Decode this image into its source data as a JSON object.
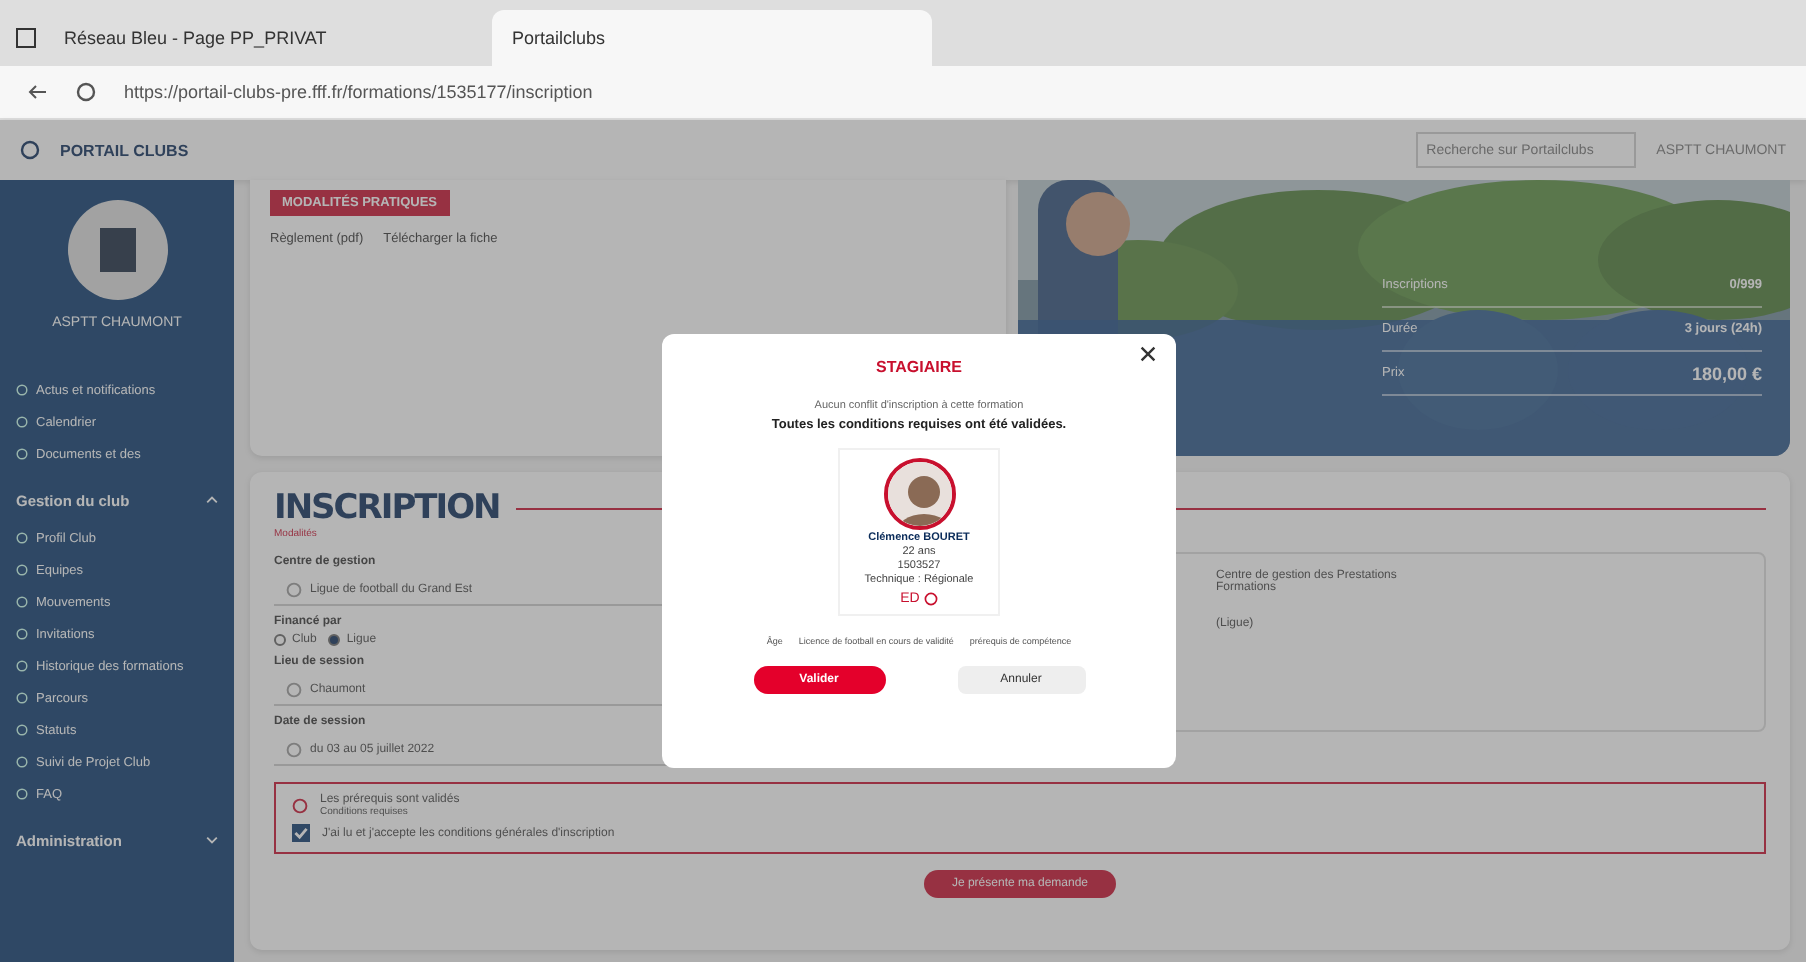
{
  "browser": {
    "tabs": [
      {
        "label": "Réseau Bleu - Page PP_PRIVAT",
        "selected": false
      },
      {
        "label": "Portailclubs",
        "selected": true
      }
    ],
    "url": "https://portail-clubs-pre.fff.fr/formations/1535177/inscription"
  },
  "header": {
    "logo": "PORTAIL CLUBS",
    "search_placeholder": "Recherche sur Portailclubs",
    "user": "ASPTT CHAUMONT"
  },
  "sidebar": {
    "club": "ASPTT CHAUMONT",
    "items": [
      {
        "label": "Actus et notifications",
        "kind": "item"
      },
      {
        "label": "Calendrier",
        "kind": "item"
      },
      {
        "label": "Documents et des",
        "kind": "item"
      },
      {
        "label": "Gestion du club",
        "kind": "section",
        "expanded": true
      },
      {
        "label": "Profil Club",
        "kind": "item"
      },
      {
        "label": "Equipes",
        "kind": "item"
      },
      {
        "label": "Mouvements",
        "kind": "item"
      },
      {
        "label": "Invitations",
        "kind": "item"
      },
      {
        "label": "Historique des formations",
        "kind": "item"
      },
      {
        "label": "Parcours",
        "kind": "item"
      },
      {
        "label": "Statuts",
        "kind": "item"
      },
      {
        "label": "Suivi de Projet Club",
        "kind": "item"
      },
      {
        "label": "FAQ",
        "kind": "item"
      },
      {
        "label": "Administration",
        "kind": "section",
        "expanded": false
      }
    ]
  },
  "info_card": {
    "badge": "MODALITÉS PRATIQUES",
    "links": [
      "Règlement (pdf)",
      "Télécharger la fiche"
    ]
  },
  "stats": [
    {
      "label": "Inscriptions",
      "value": "0/999"
    },
    {
      "label": "Durée",
      "value": "3 jours (24h)"
    },
    {
      "label": "Prix",
      "value": "180,00 €"
    }
  ],
  "inscription": {
    "title": "INSCRIPTION",
    "subtitle": "Modalités",
    "fields": [
      {
        "label": "Centre de gestion",
        "value": "Ligue de football du Grand Est",
        "kind": "select"
      },
      {
        "label": "Financé par",
        "kind": "radio",
        "options": [
          {
            "label": "Club",
            "selected": false
          },
          {
            "label": "Ligue",
            "selected": true
          }
        ]
      },
      {
        "label": "Lieu de session",
        "value": "Chaumont",
        "kind": "select"
      },
      {
        "label": "Date de session",
        "value": "du 03 au 05 juillet 2022",
        "kind": "select"
      }
    ],
    "right_note": [
      "Centre de gestion des Prestations",
      "Formations"
    ],
    "right_value": "(Ligue)",
    "warning": {
      "title": "Les prérequis sont validés",
      "subtitle": "Conditions requises",
      "checkbox": {
        "label": "J'ai lu et j'accepte les conditions générales d'inscription",
        "checked": true
      }
    },
    "submit": "Je présente ma demande"
  },
  "modal": {
    "title": "STAGIAIRE",
    "info": "Aucun conflit d'inscription à cette formation",
    "message": "Toutes les conditions requises ont été validées.",
    "person": {
      "name": "Clémence BOURET",
      "age": "22 ans",
      "license": "1503527",
      "role": "Technique : Régionale",
      "code": "ED"
    },
    "criteria": [
      "Âge",
      "Licence de football en cours de validité",
      "prérequis de compétence"
    ],
    "confirm": "Valider",
    "cancel": "Annuler"
  }
}
